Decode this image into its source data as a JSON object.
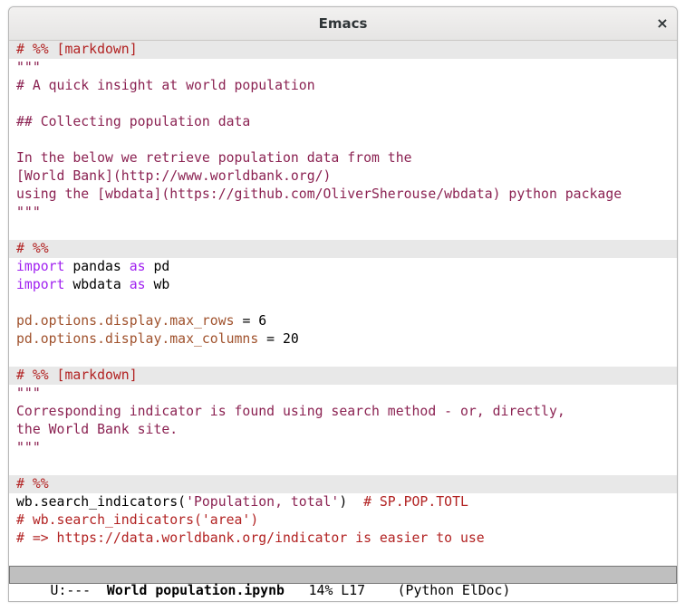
{
  "window": {
    "title": "Emacs",
    "close_glyph": "×"
  },
  "editor": {
    "lines": [
      {
        "type": "cell",
        "tokens": [
          {
            "t": "# %% [markdown]",
            "s": "comment"
          }
        ]
      },
      {
        "type": "normal",
        "tokens": [
          {
            "t": "\"\"\"",
            "s": "doc"
          }
        ]
      },
      {
        "type": "normal",
        "tokens": [
          {
            "t": "# A quick insight at world population",
            "s": "doc"
          }
        ]
      },
      {
        "type": "normal",
        "tokens": []
      },
      {
        "type": "normal",
        "tokens": [
          {
            "t": "## Collecting population data",
            "s": "doc"
          }
        ]
      },
      {
        "type": "normal",
        "tokens": []
      },
      {
        "type": "normal",
        "tokens": [
          {
            "t": "In the below we retrieve population data from the",
            "s": "doc"
          }
        ]
      },
      {
        "type": "normal",
        "tokens": [
          {
            "t": "[World Bank](http://www.worldbank.org/)",
            "s": "doc"
          }
        ]
      },
      {
        "type": "normal",
        "tokens": [
          {
            "t": "using the [wbdata](https://github.com/OliverSherouse/wbdata) python package",
            "s": "doc"
          }
        ]
      },
      {
        "type": "normal",
        "tokens": [
          {
            "t": "\"\"\"",
            "s": "doc"
          }
        ]
      },
      {
        "type": "normal",
        "tokens": []
      },
      {
        "type": "cell",
        "tokens": [
          {
            "t": "# %%",
            "s": "comment"
          }
        ]
      },
      {
        "type": "normal",
        "tokens": [
          {
            "t": "import",
            "s": "kw"
          },
          {
            "t": " pandas ",
            "s": "plain"
          },
          {
            "t": "as",
            "s": "kw"
          },
          {
            "t": " pd",
            "s": "plain"
          }
        ]
      },
      {
        "type": "normal",
        "tokens": [
          {
            "t": "import",
            "s": "kw"
          },
          {
            "t": " wbdata ",
            "s": "plain"
          },
          {
            "t": "as",
            "s": "kw"
          },
          {
            "t": " wb",
            "s": "plain"
          }
        ]
      },
      {
        "type": "normal",
        "tokens": []
      },
      {
        "type": "normal",
        "tokens": [
          {
            "t": "pd.options.display.max_rows",
            "s": "var"
          },
          {
            "t": " = 6",
            "s": "plain"
          }
        ]
      },
      {
        "type": "normal",
        "tokens": [
          {
            "t": "pd.options.display.max_columns",
            "s": "var"
          },
          {
            "t": " = 20",
            "s": "plain"
          }
        ]
      },
      {
        "type": "normal",
        "tokens": []
      },
      {
        "type": "cell",
        "tokens": [
          {
            "t": "# %% [markdown]",
            "s": "comment"
          }
        ]
      },
      {
        "type": "normal",
        "tokens": [
          {
            "t": "\"\"\"",
            "s": "doc"
          }
        ]
      },
      {
        "type": "normal",
        "tokens": [
          {
            "t": "Corresponding indicator is found using search method - or, directly,",
            "s": "doc"
          }
        ]
      },
      {
        "type": "normal",
        "tokens": [
          {
            "t": "the World Bank site.",
            "s": "doc"
          }
        ]
      },
      {
        "type": "normal",
        "tokens": [
          {
            "t": "\"\"\"",
            "s": "doc"
          }
        ]
      },
      {
        "type": "normal",
        "tokens": []
      },
      {
        "type": "cell",
        "tokens": [
          {
            "t": "# %%",
            "s": "comment"
          }
        ]
      },
      {
        "type": "normal",
        "tokens": [
          {
            "t": "wb.search_indicators(",
            "s": "plain"
          },
          {
            "t": "'Population, total'",
            "s": "str"
          },
          {
            "t": ")  ",
            "s": "plain"
          },
          {
            "t": "# SP.POP.TOTL",
            "s": "comment"
          }
        ]
      },
      {
        "type": "normal",
        "tokens": [
          {
            "t": "# wb.search_indicators('area')",
            "s": "comment"
          }
        ]
      },
      {
        "type": "normal",
        "tokens": [
          {
            "t": "# => https://data.worldbank.org/indicator is easier to use",
            "s": "comment"
          }
        ]
      },
      {
        "type": "normal",
        "tokens": []
      }
    ]
  },
  "modeline": {
    "status": " U:---  ",
    "buffer_name": "World population.ipynb",
    "position": "   14% L17    ",
    "mode": "(Python ElDoc)"
  }
}
